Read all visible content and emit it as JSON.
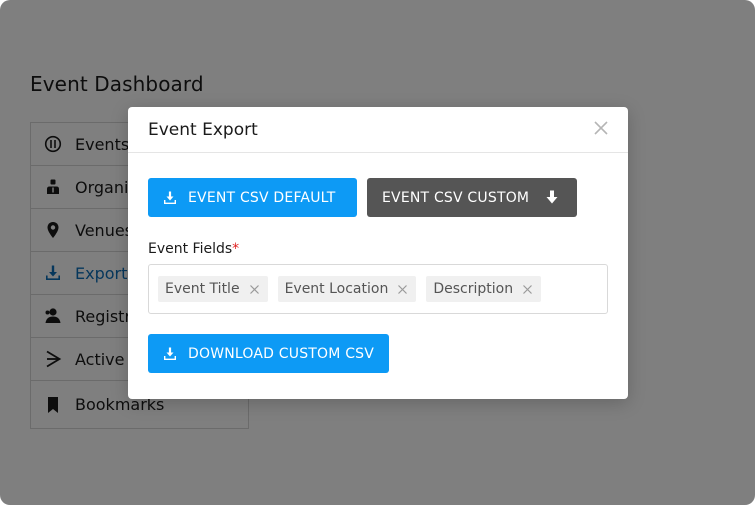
{
  "page": {
    "title": "Event Dashboard"
  },
  "sidebar": {
    "items": [
      {
        "label": "Events",
        "icon": "info-icon",
        "active": false
      },
      {
        "label": "Organi",
        "icon": "organizer-icon",
        "active": false
      },
      {
        "label": "Venues",
        "icon": "location-pin-icon",
        "active": false
      },
      {
        "label": "Exports",
        "icon": "download-icon",
        "active": true
      },
      {
        "label": "Registr",
        "icon": "person-icon",
        "active": false
      },
      {
        "label": "Active",
        "icon": "chevron-right-icon",
        "active": false
      },
      {
        "label": "Bookmarks",
        "icon": "bookmark-icon",
        "active": false
      }
    ]
  },
  "modal": {
    "title": "Event Export",
    "default_button": "EVENT CSV DEFAULT",
    "custom_button": "EVENT CSV CUSTOM",
    "fields_label": "Event Fields",
    "required_marker": "*",
    "tags": [
      "Event Title",
      "Event Location",
      "Description"
    ],
    "download_button": "DOWNLOAD CUSTOM CSV"
  },
  "colors": {
    "primary": "#0d9af5",
    "dark_button": "#555555",
    "active_link": "#0d6fb8",
    "required": "#e02020"
  }
}
